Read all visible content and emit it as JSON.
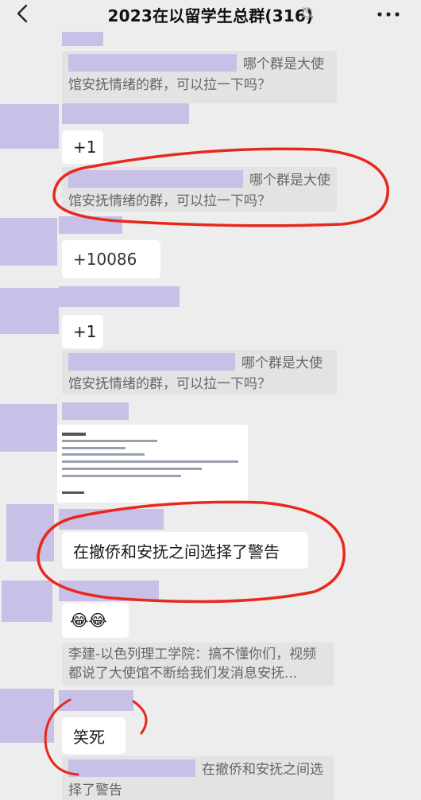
{
  "header": {
    "title": "2023在以留学生总群(316)",
    "back_icon": "chevron-left-icon",
    "mute_icon": "bell-mute-icon",
    "more_icon": "more-dots-icon"
  },
  "messages": {
    "quote1": "哪个群是大使馆安抚情绪的群，可以拉一下吗？",
    "plus1_a": "+1",
    "quote2": "哪个群是大使馆安抚情绪的群，可以拉一下吗？",
    "phone": "+10086",
    "plus1_b": "+1",
    "quote3": "哪个群是大使馆安抚情绪的群，可以拉一下吗？",
    "warning": "在撤侨和安抚之间选择了警告",
    "emoji": "😂😂",
    "quote4": "李建-以色列理工学院：搞不懂你们，视频都说了大使馆不断给我们发消息安抚...",
    "laugh": "笑死",
    "quote5": "在撤侨和安抚之间选择了警告"
  },
  "colors": {
    "background": "#ededed",
    "bubble": "#ffffff",
    "quote_bg": "#e3e3e3",
    "mask": "#c8c0e6",
    "annotation": "#e8281c"
  }
}
